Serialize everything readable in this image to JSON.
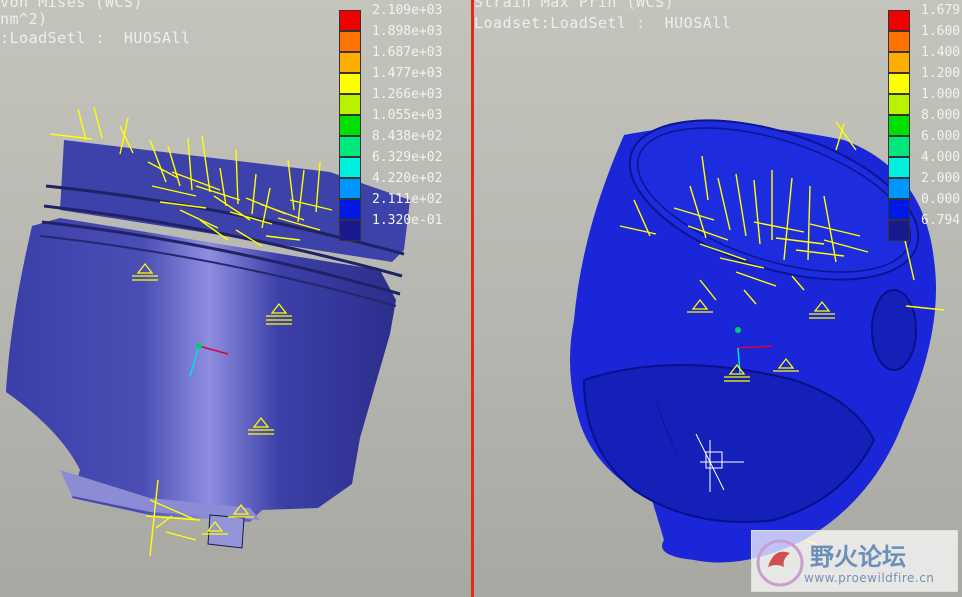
{
  "colors": {
    "accent": "#e02a1a"
  },
  "left_view": {
    "title_line1": "von Mises (WCS)",
    "title_line2": "nm^2)",
    "title_line3": ":LoadSetl :  HUOSAll",
    "legend": {
      "colors": [
        "#f20000",
        "#ff7200",
        "#ffae00",
        "#ffff00",
        "#b8f200",
        "#00e000",
        "#00e87c",
        "#00f0e0",
        "#0096ff",
        "#0018e8",
        "#1a1a90"
      ],
      "labels": [
        "2.109e+03",
        "1.898e+03",
        "1.687e+03",
        "1.477e+03",
        "1.266e+03",
        "1.055e+03",
        "8.438e+02",
        "6.329e+02",
        "4.220e+02",
        "2.111e+02",
        "1.320e-01"
      ]
    }
  },
  "right_view": {
    "title_line1": "Strain Max Prin (WCS)",
    "title_line2": "Loadset:LoadSetl :  HUOSAll",
    "legend": {
      "colors": [
        "#f20000",
        "#ff7200",
        "#ffae00",
        "#ffff00",
        "#b8f200",
        "#00e000",
        "#00e87c",
        "#00f0e0",
        "#0096ff",
        "#0018e8",
        "#1a1a90"
      ],
      "labels": [
        "1.679",
        "1.600",
        "1.400",
        "1.200",
        "1.000",
        "8.000",
        "6.000",
        "4.000",
        "2.000",
        "0.000",
        "6.794"
      ]
    }
  },
  "watermark": {
    "name": "野火论坛",
    "url": "www.proewildfire.cn"
  }
}
